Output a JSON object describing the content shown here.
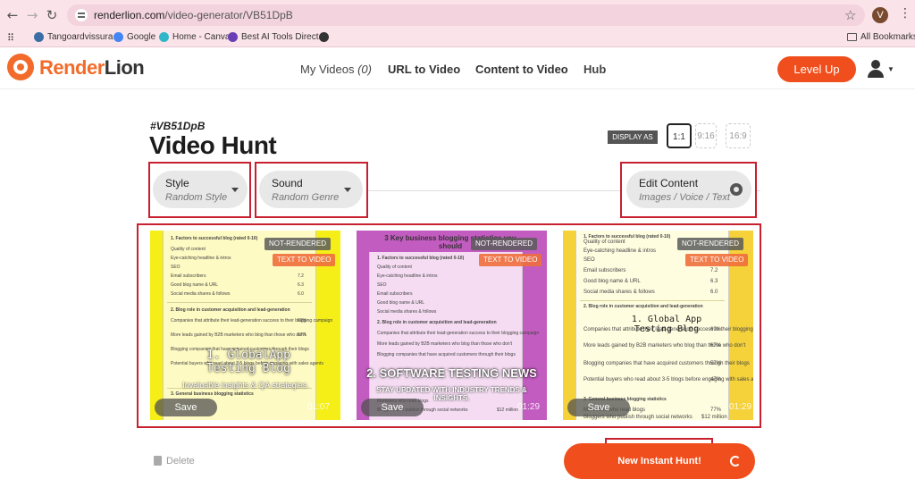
{
  "browser": {
    "url_host": "renderlion.com",
    "url_path": "/video-generator/VB51DpB",
    "profile_initial": "V",
    "bookmarks": [
      "Tangoardvissura ·",
      "Google",
      "Home - Canva",
      "Best AI Tools Direct..."
    ],
    "all_bookmarks": "All Bookmarks"
  },
  "site": {
    "logo_prefix": "Render",
    "logo_suffix": "Lion",
    "nav": {
      "my_videos": "My Videos",
      "my_videos_count": "(0)",
      "url_to_video": "URL to Video",
      "content_to_video": "Content to Video",
      "hub": "Hub"
    },
    "level_up": "Level Up"
  },
  "page": {
    "hunt_id": "#VB51DpB",
    "title": "Video Hunt",
    "display_as": "DISPLAY AS",
    "ratios": [
      "1:1",
      "9:16",
      "16:9"
    ]
  },
  "controls": {
    "style": {
      "label": "Style",
      "value": "Random Style"
    },
    "sound": {
      "label": "Sound",
      "value": "Random Genre"
    },
    "edit": {
      "label": "Edit Content",
      "value": "Images / Voice / Text"
    }
  },
  "cards": [
    {
      "status": "NOT-RENDERED",
      "type": "TEXT TO VIDEO",
      "title": "1. GlobalApp Testing Blog",
      "subtitle": "Invaluable insights & QA strategies.",
      "save": "Save",
      "duration": "01:07",
      "bg_color": "#f5ef17"
    },
    {
      "status": "NOT-RENDERED",
      "type": "TEXT TO VIDEO",
      "title": "2. SOFTWARE TESTING NEWS",
      "subtitle": "STAY UPDATED WITH INDUSTRY TRENDS & INSIGHTS.",
      "header": "3 Key business blogging statistics you should",
      "save": "Save",
      "duration": "01:29",
      "bg_color": "#c35cc0"
    },
    {
      "status": "NOT-RENDERED",
      "type": "TEXT TO VIDEO",
      "title": "1. Global App Testing Blog",
      "save": "Save",
      "duration": "01:29",
      "bg_color": "#f5d23a"
    }
  ],
  "sheet_rows": [
    "1. Factors to successful blog (rated 0-10)",
    "Quality of content",
    "Eye-catching headline & intros",
    "SEO",
    "Email subscribers",
    "Good blog name & URL",
    "Social media shares & follows",
    "2. Blog role in customer acquisition and lead-generation",
    "Companies that attribute their lead-generation success to their blogging campaign",
    "More leads gained by B2B marketers who blog than those who don't",
    "Blogging companies that have acquired customers through their blogs",
    "Potential buyers who read about 3-5 blogs before engaging with sales agents",
    "3. General business blogging statistics",
    "Marketers who read blogs",
    "Bloggers who publish through social networks"
  ],
  "sheet_values": [
    "8.2",
    "7.2",
    "6.3",
    "6.0",
    "69%",
    "67%",
    "57%",
    "47%",
    "77%",
    "$12 million"
  ],
  "footer": {
    "delete": "Delete",
    "new_hunt": "New Instant Hunt!"
  }
}
